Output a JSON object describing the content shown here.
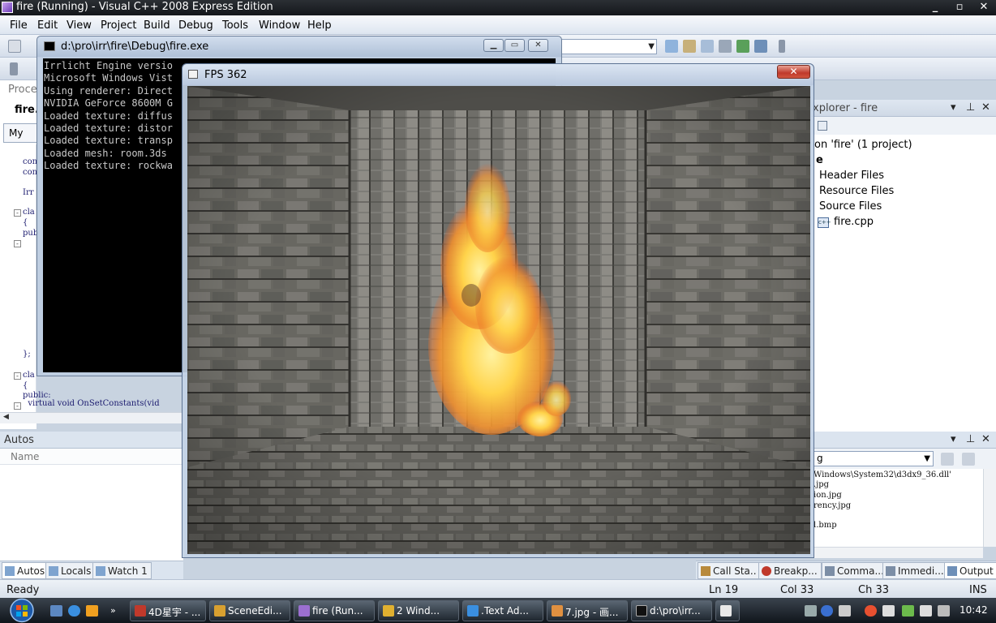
{
  "window": {
    "title": "fire (Running) - Visual C++ 2008 Express Edition",
    "controls": [
      "_",
      "▫",
      "✕"
    ]
  },
  "menu": [
    "File",
    "Edit",
    "View",
    "Project",
    "Build",
    "Debug",
    "Tools",
    "Window",
    "Help"
  ],
  "left_panel": {
    "process_label": "Proce",
    "doc_tab": "fire.",
    "my_tab": "My",
    "code_lines": [
      "con",
      "con",
      "Irr",
      "cla",
      "{",
      "pub",
      "};",
      "cla"
    ],
    "code_bottom": [
      "{",
      "public:",
      "  virtual void OnSetConstants(vid"
    ]
  },
  "autos": {
    "title": "Autos",
    "column_name": "Name"
  },
  "console": {
    "title": "d:\\pro\\irr\\fire\\Debug\\fire.exe",
    "lines": [
      "Irrlicht Engine versio",
      "Microsoft Windows Vist",
      "Using renderer: Direct",
      "NVIDIA GeForce 8600M G",
      "Loaded texture: diffus",
      "Loaded texture: distor",
      "Loaded texture: transp",
      "Loaded mesh: room.3ds",
      "Loaded texture: rockwa"
    ]
  },
  "render_window": {
    "title": "FPS 362",
    "close": "✕"
  },
  "solution_explorer": {
    "title": "xplorer - fire",
    "tree": [
      "on 'fire' (1 project)",
      "e",
      "Header Files",
      "Resource Files",
      "Source Files",
      "fire.cpp"
    ],
    "file_icon_label": "c++"
  },
  "output": {
    "combo_value": "g",
    "lines": [
      "Windows\\System32\\d3dx9_36.dll'",
      ".jpg",
      "ion.jpg",
      "rency.jpg",
      "",
      "l.bmp"
    ]
  },
  "bottom_tabs_left": [
    {
      "label": "Autos",
      "active": true
    },
    {
      "label": "Locals",
      "active": false
    },
    {
      "label": "Watch 1",
      "active": false
    }
  ],
  "bottom_tabs_right": [
    {
      "label": "Call Sta..",
      "active": false
    },
    {
      "label": "Breakp...",
      "active": false
    },
    {
      "label": "Comma...",
      "active": false
    },
    {
      "label": "Immedi...",
      "active": false
    },
    {
      "label": "Output",
      "active": true
    }
  ],
  "status": {
    "ready": "Ready",
    "ln": "Ln 19",
    "col": "Col 33",
    "ch": "Ch 33",
    "ins": "INS"
  },
  "taskbar": {
    "buttons": [
      "4D星宇 - ...",
      "SceneEdi...",
      "fire (Run...",
      "2 Wind...",
      ".Text Ad...",
      "7.jpg - 画...",
      "d:\\pro\\irr..."
    ],
    "clock": "10:42"
  },
  "colors": {
    "accent": "#c0392b",
    "brick": "#807e78",
    "fire_core": "#ffd34a",
    "fire_outer": "#e8602a"
  }
}
